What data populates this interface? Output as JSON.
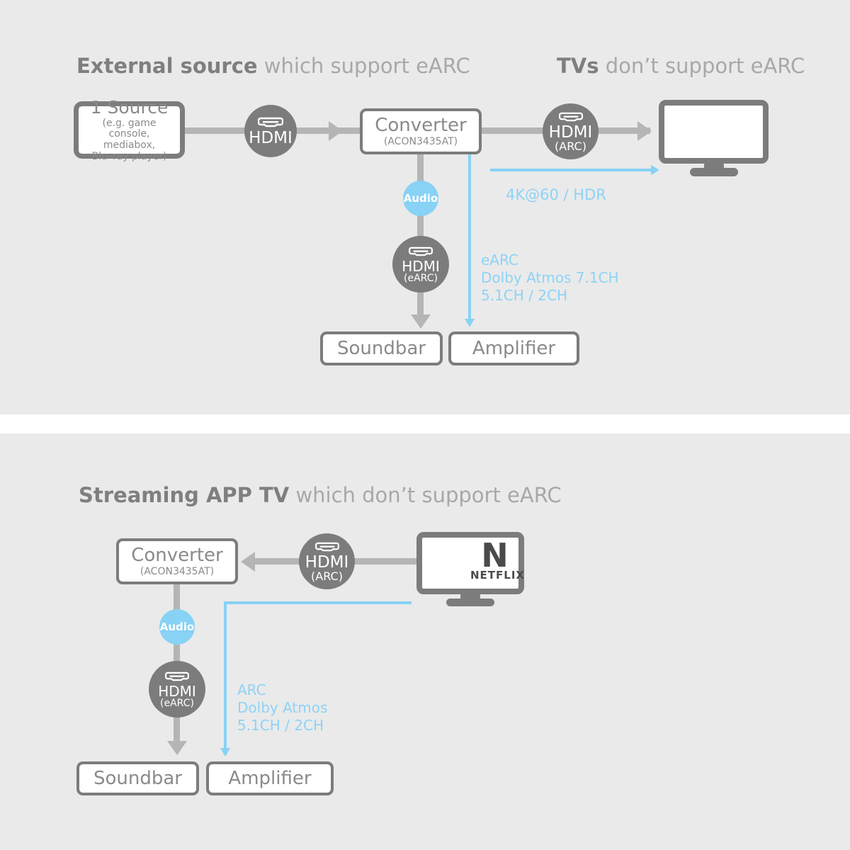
{
  "panels": [
    {
      "id": "top",
      "heading": {
        "strong": "External source",
        "light": " which support eARC"
      },
      "heading2": {
        "strong": "TVs",
        "light": " don’t support eARC"
      },
      "source_box": {
        "title": "1 Source",
        "detail_line1": "(e.g. game console,",
        "detail_line2": "mediabox,",
        "detail_line3": "Blu–ray player)"
      },
      "converter": {
        "title": "Converter",
        "model": "(ACON3435AT)"
      },
      "hdmi_in": {
        "label": "HDMI",
        "sub": ""
      },
      "hdmi_arc": {
        "label": "HDMI",
        "sub": "(ARC)"
      },
      "audio_badge": {
        "label": "Audio"
      },
      "hdmi_earc": {
        "label": "HDMI",
        "sub": "(eARC)"
      },
      "soundbar": {
        "title": "Soundbar"
      },
      "amplifier": {
        "title": "Amplifier"
      },
      "video_spec": "4K@60 / HDR",
      "audio_spec_line1": "eARC",
      "audio_spec_line2": "Dolby Atmos 7.1CH",
      "audio_spec_line3": "5.1CH / 2CH",
      "tv": {
        "app": "",
        "app_word": ""
      }
    },
    {
      "id": "bottom",
      "heading": {
        "strong": "Streaming APP TV",
        "light": " which don’t support eARC"
      },
      "converter": {
        "title": "Converter",
        "model": "(ACON3435AT)"
      },
      "hdmi_arc": {
        "label": "HDMI",
        "sub": "(ARC)"
      },
      "audio_badge": {
        "label": "Audio"
      },
      "hdmi_earc": {
        "label": "HDMI",
        "sub": "(eARC)"
      },
      "soundbar": {
        "title": "Soundbar"
      },
      "amplifier": {
        "title": "Amplifier"
      },
      "audio_spec_line1": "ARC",
      "audio_spec_line2": "Dolby Atmos",
      "audio_spec_line3": "5.1CH / 2CH",
      "tv": {
        "app": "N",
        "app_word": "NETFLIX"
      }
    }
  ],
  "colors": {
    "panel_bg": "#eaeaea",
    "gray": "#7c7c7c",
    "line_gray": "#b5b5b5",
    "blue": "#87d2f5",
    "text_gray": "#8a8a8a"
  },
  "icons": {
    "hdmi": "hdmi-port-icon"
  }
}
